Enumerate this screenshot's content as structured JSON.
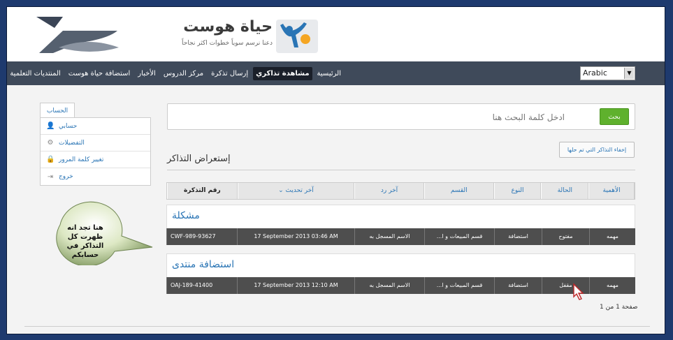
{
  "brand": {
    "title": "حياة هوست",
    "tagline": "دعنا نرسم سوياً خطوات اكثر نجاحاً"
  },
  "language": {
    "selected": "Arabic"
  },
  "nav": {
    "items": [
      {
        "label": "الرئيسية",
        "active": false
      },
      {
        "label": "مشاهدة تذاكري",
        "active": true
      },
      {
        "label": "إرسال تذكرة",
        "active": false
      },
      {
        "label": "مركز الدروس",
        "active": false
      },
      {
        "label": "الأخبار",
        "active": false
      },
      {
        "label": "استضافة حياة هوست",
        "active": false
      },
      {
        "label": "المنتديات التعلمية",
        "active": false
      }
    ]
  },
  "sidebar": {
    "tab": "الحساب",
    "items": [
      {
        "label": "حسابي",
        "icon": "user-icon"
      },
      {
        "label": "التفضيلات",
        "icon": "gear-icon"
      },
      {
        "label": "تغيير كلمة المرور",
        "icon": "lock-icon"
      },
      {
        "label": "خروج",
        "icon": "logout-icon"
      }
    ]
  },
  "search": {
    "placeholder": "ادخل كلمة البحث هنا",
    "button": "بحث"
  },
  "page": {
    "title": "إستعراض التذاكر",
    "hide_closed": "إخفاء التذاكر التي تم حلها"
  },
  "table": {
    "columns": [
      "الأهمية",
      "الحالة",
      "النوع",
      "القسم",
      "آخر رد",
      "⌄ آخر تحديث",
      "رقم التذكرة"
    ],
    "tickets": [
      {
        "title": "مشكلة",
        "cells": [
          "مهمه",
          "مفتوح",
          "استضافة",
          "...قسم المبيعات و ا",
          "الاسم المسجل به",
          "17 September 2013 03:46 AM",
          "CWF-989-93627"
        ]
      },
      {
        "title": "استضافة منتدى",
        "cells": [
          "مهمه",
          "مقفل",
          "استضافة",
          "...قسم المبيعات و ا",
          "الاسم المسجل به",
          "17 September 2013 12:10 AM",
          "OAJ-189-41400"
        ]
      }
    ]
  },
  "pager": "صفحة 1 من 1",
  "callout": {
    "text": "هنا تجد انه ظهرت كل التذاكر في حسابكم"
  },
  "colors": {
    "navbar": "#3f4a5a",
    "accent": "#2a75b5",
    "search_button": "#5fb12d",
    "row_bg": "#4e4e4e",
    "frame": "#1e3a6e"
  }
}
